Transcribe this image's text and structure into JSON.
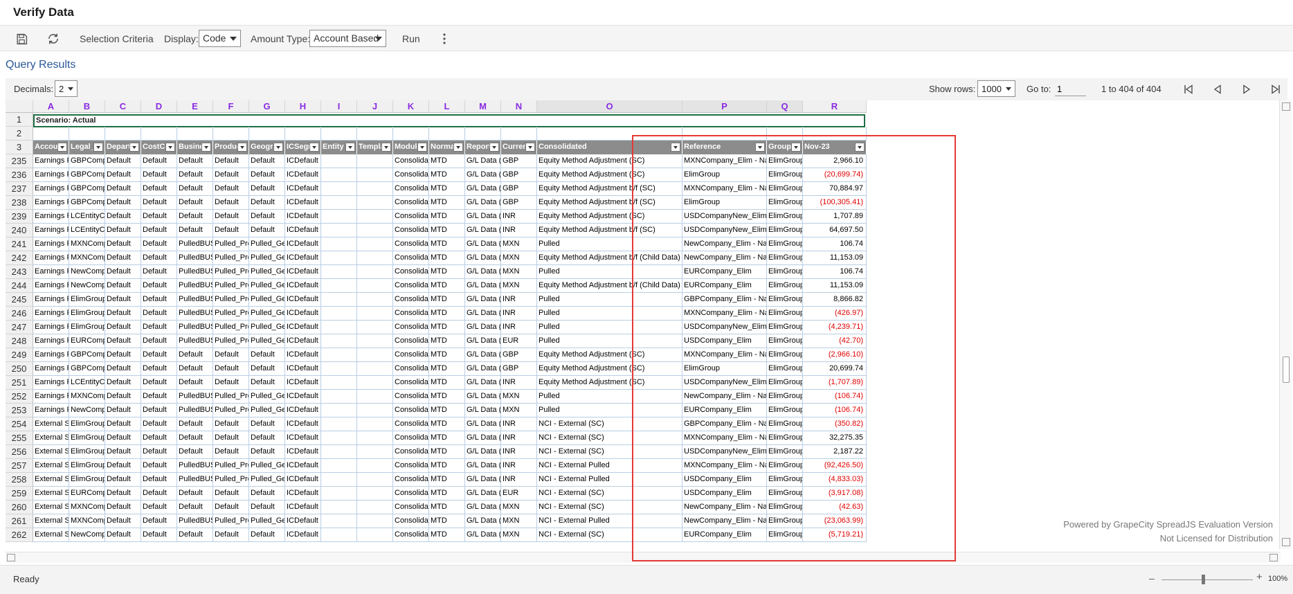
{
  "title": "Verify Data",
  "toolbar": {
    "save_icon": "save-icon",
    "refresh_icon": "refresh-icon",
    "selection_criteria": "Selection Criteria",
    "display_label": "Display:",
    "display_value": "Code",
    "amount_type_label": "Amount Type:",
    "amount_type_value": "Account Based",
    "run": "Run",
    "more_icon": "more-vertical-icon"
  },
  "query_results": {
    "title": "Query Results",
    "decimals_label": "Decimals:",
    "decimals_value": "2",
    "show_rows_label": "Show rows:",
    "show_rows_value": "1000",
    "goto_label": "Go to:",
    "goto_value": "1",
    "range_text": "1 to 404 of 404"
  },
  "sheet": {
    "column_letters": [
      "A",
      "B",
      "C",
      "D",
      "E",
      "F",
      "G",
      "H",
      "I",
      "J",
      "K",
      "L",
      "M",
      "N",
      "O",
      "P",
      "Q",
      "R"
    ],
    "scenario": "Scenario: Actual",
    "headers": [
      "Account",
      "Legal_E",
      "Departm",
      "CostCen",
      "Busines",
      "Product",
      "Geograp",
      "ICSegm",
      "Entity",
      "Templat",
      "Module",
      "Normal",
      "Report",
      "Curren",
      "Consolidated",
      "Reference",
      "Groups",
      "Nov-23"
    ],
    "rows": [
      {
        "n": "235",
        "c": [
          "Earnings Re",
          "GBPCompa",
          "Default",
          "Default",
          "Default",
          "Default",
          "Default",
          "ICDefault",
          "",
          "",
          "Consolidatio",
          "MTD",
          "G/L Data (L(",
          "GBP",
          "Equity Method Adjustment (SC)",
          "MXNCompany_Elim - Name&",
          "ElimGroup",
          "2,966.10"
        ],
        "neg": false
      },
      {
        "n": "236",
        "c": [
          "Earnings Re",
          "GBPCompa",
          "Default",
          "Default",
          "Default",
          "Default",
          "Default",
          "ICDefault",
          "",
          "",
          "Consolidatio",
          "MTD",
          "G/L Data (L(",
          "GBP",
          "Equity Method Adjustment (SC)",
          "ElimGroup",
          "ElimGroup",
          "(20,699.74)"
        ],
        "neg": true
      },
      {
        "n": "237",
        "c": [
          "Earnings Re",
          "GBPCompa",
          "Default",
          "Default",
          "Default",
          "Default",
          "Default",
          "ICDefault",
          "",
          "",
          "Consolidatio",
          "MTD",
          "G/L Data (L(",
          "GBP",
          "Equity Method Adjustment b/f (SC)",
          "MXNCompany_Elim - Name&",
          "ElimGroup",
          "70,884.97"
        ],
        "neg": false
      },
      {
        "n": "238",
        "c": [
          "Earnings Re",
          "GBPCompa",
          "Default",
          "Default",
          "Default",
          "Default",
          "Default",
          "ICDefault",
          "",
          "",
          "Consolidatio",
          "MTD",
          "G/L Data (L(",
          "GBP",
          "Equity Method Adjustment b/f (SC)",
          "ElimGroup",
          "ElimGroup",
          "(100,305.41)"
        ],
        "neg": true
      },
      {
        "n": "239",
        "c": [
          "Earnings Re",
          "LCEntityCCI",
          "Default",
          "Default",
          "Default",
          "Default",
          "Default",
          "ICDefault",
          "",
          "",
          "Consolidatio",
          "MTD",
          "G/L Data (L(",
          "INR",
          "Equity Method Adjustment (SC)",
          "USDCompanyNew_Elim",
          "ElimGroup",
          "1,707.89"
        ],
        "neg": false
      },
      {
        "n": "240",
        "c": [
          "Earnings Re",
          "LCEntityCCI",
          "Default",
          "Default",
          "Default",
          "Default",
          "Default",
          "ICDefault",
          "",
          "",
          "Consolidatio",
          "MTD",
          "G/L Data (L(",
          "INR",
          "Equity Method Adjustment b/f (SC)",
          "USDCompanyNew_Elim",
          "ElimGroup",
          "64,697.50"
        ],
        "neg": false
      },
      {
        "n": "241",
        "c": [
          "Earnings Re",
          "MXNCompa",
          "Default",
          "Default",
          "PulledBUS_",
          "Pulled_Prod",
          "Pulled_Geo",
          "ICDefault",
          "",
          "",
          "Consolidatio",
          "MTD",
          "G/L Data (L(",
          "MXN",
          "Pulled",
          "NewCompany_Elim - Name",
          "ElimGroup",
          "106.74"
        ],
        "neg": false
      },
      {
        "n": "242",
        "c": [
          "Earnings Re",
          "MXNCompa",
          "Default",
          "Default",
          "PulledBUS_",
          "Pulled_Prod",
          "Pulled_Geo",
          "ICDefault",
          "",
          "",
          "Consolidatio",
          "MTD",
          "G/L Data (L(",
          "MXN",
          "Equity Method Adjustment b/f (Child Data)",
          "NewCompany_Elim - Name",
          "ElimGroup",
          "11,153.09"
        ],
        "neg": false
      },
      {
        "n": "243",
        "c": [
          "Earnings Re",
          "NewCompa",
          "Default",
          "Default",
          "PulledBUS_",
          "Pulled_Prod",
          "Pulled_Geo",
          "ICDefault",
          "",
          "",
          "Consolidatio",
          "MTD",
          "G/L Data (L(",
          "MXN",
          "Pulled",
          "EURCompany_Elim",
          "ElimGroup",
          "106.74"
        ],
        "neg": false
      },
      {
        "n": "244",
        "c": [
          "Earnings Re",
          "NewCompa",
          "Default",
          "Default",
          "PulledBUS_",
          "Pulled_Prod",
          "Pulled_Geo",
          "ICDefault",
          "",
          "",
          "Consolidatio",
          "MTD",
          "G/L Data (L(",
          "MXN",
          "Equity Method Adjustment b/f (Child Data)",
          "EURCompany_Elim",
          "ElimGroup",
          "11,153.09"
        ],
        "neg": false
      },
      {
        "n": "245",
        "c": [
          "Earnings Re",
          "ElimGroup",
          "Default",
          "Default",
          "PulledBUS_",
          "Pulled_Prod",
          "Pulled_Geo",
          "ICDefault",
          "",
          "",
          "Consolidatio",
          "MTD",
          "G/L Data (L(",
          "INR",
          "Pulled",
          "GBPCompany_Elim - Name",
          "ElimGroup",
          "8,866.82"
        ],
        "neg": false
      },
      {
        "n": "246",
        "c": [
          "Earnings Re",
          "ElimGroup",
          "Default",
          "Default",
          "PulledBUS_",
          "Pulled_Prod",
          "Pulled_Geo",
          "ICDefault",
          "",
          "",
          "Consolidatio",
          "MTD",
          "G/L Data (L(",
          "INR",
          "Pulled",
          "MXNCompany_Elim - Name&",
          "ElimGroup",
          "(426.97)"
        ],
        "neg": true
      },
      {
        "n": "247",
        "c": [
          "Earnings Re",
          "ElimGroup",
          "Default",
          "Default",
          "PulledBUS_",
          "Pulled_Prod",
          "Pulled_Geo",
          "ICDefault",
          "",
          "",
          "Consolidatio",
          "MTD",
          "G/L Data (L(",
          "INR",
          "Pulled",
          "USDCompanyNew_Elim",
          "ElimGroup",
          "(4,239.71)"
        ],
        "neg": true
      },
      {
        "n": "248",
        "c": [
          "Earnings Re",
          "EURCompa",
          "Default",
          "Default",
          "PulledBUS_",
          "Pulled_Prod",
          "Pulled_Geo",
          "ICDefault",
          "",
          "",
          "Consolidatio",
          "MTD",
          "G/L Data (L(",
          "EUR",
          "Pulled",
          "USDCompany_Elim",
          "ElimGroup",
          "(42.70)"
        ],
        "neg": true
      },
      {
        "n": "249",
        "c": [
          "Earnings Re",
          "GBPCompa",
          "Default",
          "Default",
          "Default",
          "Default",
          "Default",
          "ICDefault",
          "",
          "",
          "Consolidatio",
          "MTD",
          "G/L Data (L(",
          "GBP",
          "Equity Method Adjustment (SC)",
          "MXNCompany_Elim - Name&",
          "ElimGroup",
          "(2,966.10)"
        ],
        "neg": true
      },
      {
        "n": "250",
        "c": [
          "Earnings Re",
          "GBPCompa",
          "Default",
          "Default",
          "Default",
          "Default",
          "Default",
          "ICDefault",
          "",
          "",
          "Consolidatio",
          "MTD",
          "G/L Data (L(",
          "GBP",
          "Equity Method Adjustment (SC)",
          "ElimGroup",
          "ElimGroup",
          "20,699.74"
        ],
        "neg": false
      },
      {
        "n": "251",
        "c": [
          "Earnings Re",
          "LCEntityCCI",
          "Default",
          "Default",
          "Default",
          "Default",
          "Default",
          "ICDefault",
          "",
          "",
          "Consolidatio",
          "MTD",
          "G/L Data (L(",
          "INR",
          "Equity Method Adjustment (SC)",
          "USDCompanyNew_Elim",
          "ElimGroup",
          "(1,707.89)"
        ],
        "neg": true
      },
      {
        "n": "252",
        "c": [
          "Earnings Re",
          "MXNCompa",
          "Default",
          "Default",
          "PulledBUS_",
          "Pulled_Prod",
          "Pulled_Geo",
          "ICDefault",
          "",
          "",
          "Consolidatio",
          "MTD",
          "G/L Data (L(",
          "MXN",
          "Pulled",
          "NewCompany_Elim - Name",
          "ElimGroup",
          "(106.74)"
        ],
        "neg": true
      },
      {
        "n": "253",
        "c": [
          "Earnings Re",
          "NewCompa",
          "Default",
          "Default",
          "PulledBUS_",
          "Pulled_Prod",
          "Pulled_Geo",
          "ICDefault",
          "",
          "",
          "Consolidatio",
          "MTD",
          "G/L Data (L(",
          "MXN",
          "Pulled",
          "EURCompany_Elim",
          "ElimGroup",
          "(106.74)"
        ],
        "neg": true
      },
      {
        "n": "254",
        "c": [
          "External Sha",
          "ElimGroup",
          "Default",
          "Default",
          "Default",
          "Default",
          "Default",
          "ICDefault",
          "",
          "",
          "Consolidatio",
          "MTD",
          "G/L Data (L(",
          "INR",
          "NCI - External (SC)",
          "GBPCompany_Elim - Name",
          "ElimGroup",
          "(350.82)"
        ],
        "neg": true
      },
      {
        "n": "255",
        "c": [
          "External Sha",
          "ElimGroup",
          "Default",
          "Default",
          "Default",
          "Default",
          "Default",
          "ICDefault",
          "",
          "",
          "Consolidatio",
          "MTD",
          "G/L Data (L(",
          "INR",
          "NCI - External (SC)",
          "MXNCompany_Elim - Name&",
          "ElimGroup",
          "32,275.35"
        ],
        "neg": false
      },
      {
        "n": "256",
        "c": [
          "External Sha",
          "ElimGroup",
          "Default",
          "Default",
          "Default",
          "Default",
          "Default",
          "ICDefault",
          "",
          "",
          "Consolidatio",
          "MTD",
          "G/L Data (L(",
          "INR",
          "NCI - External (SC)",
          "USDCompanyNew_Elim",
          "ElimGroup",
          "2,187.22"
        ],
        "neg": false
      },
      {
        "n": "257",
        "c": [
          "External Sha",
          "ElimGroup",
          "Default",
          "Default",
          "PulledBUS_",
          "Pulled_Prod",
          "Pulled_Geo",
          "ICDefault",
          "",
          "",
          "Consolidatio",
          "MTD",
          "G/L Data (L(",
          "INR",
          "NCI - External Pulled",
          "MXNCompany_Elim - Name&",
          "ElimGroup",
          "(92,426.50)"
        ],
        "neg": true
      },
      {
        "n": "258",
        "c": [
          "External Sha",
          "ElimGroup",
          "Default",
          "Default",
          "PulledBUS_",
          "Pulled_Prod",
          "Pulled_Geo",
          "ICDefault",
          "",
          "",
          "Consolidatio",
          "MTD",
          "G/L Data (L(",
          "INR",
          "NCI - External Pulled",
          "USDCompany_Elim",
          "ElimGroup",
          "(4,833.03)"
        ],
        "neg": true
      },
      {
        "n": "259",
        "c": [
          "External Sha",
          "EURCompa",
          "Default",
          "Default",
          "Default",
          "Default",
          "Default",
          "ICDefault",
          "",
          "",
          "Consolidatio",
          "MTD",
          "G/L Data (L(",
          "EUR",
          "NCI - External (SC)",
          "USDCompany_Elim",
          "ElimGroup",
          "(3,917.08)"
        ],
        "neg": true
      },
      {
        "n": "260",
        "c": [
          "External Sha",
          "MXNCompa",
          "Default",
          "Default",
          "Default",
          "Default",
          "Default",
          "ICDefault",
          "",
          "",
          "Consolidatio",
          "MTD",
          "G/L Data (L(",
          "MXN",
          "NCI - External (SC)",
          "NewCompany_Elim - Name",
          "ElimGroup",
          "(42.63)"
        ],
        "neg": true
      },
      {
        "n": "261",
        "c": [
          "External Sha",
          "MXNCompa",
          "Default",
          "Default",
          "PulledBUS_",
          "Pulled_Prod",
          "Pulled_Geo",
          "ICDefault",
          "",
          "",
          "Consolidatio",
          "MTD",
          "G/L Data (L(",
          "MXN",
          "NCI - External Pulled",
          "NewCompany_Elim - Name",
          "ElimGroup",
          "(23,063.99)"
        ],
        "neg": true
      },
      {
        "n": "262",
        "c": [
          "External Sha",
          "NewCompa",
          "Default",
          "Default",
          "Default",
          "Default",
          "Default",
          "ICDefault",
          "",
          "",
          "Consolidatio",
          "MTD",
          "G/L Data (L(",
          "MXN",
          "NCI - External (SC)",
          "EURCompany_Elim",
          "ElimGroup",
          "(5,719.21)"
        ],
        "neg": true
      }
    ]
  },
  "watermark": {
    "line1": "Powered by GrapeCity SpreadJS Evaluation Version",
    "line2": "Not Licensed for Distribution"
  },
  "status": {
    "text": "Ready",
    "zoom": "100%"
  },
  "colors": {
    "highlight_box": "#e53935",
    "negative": "#e00000",
    "header_bg": "#8c8c8c",
    "col_letter": "#8a2be2"
  }
}
